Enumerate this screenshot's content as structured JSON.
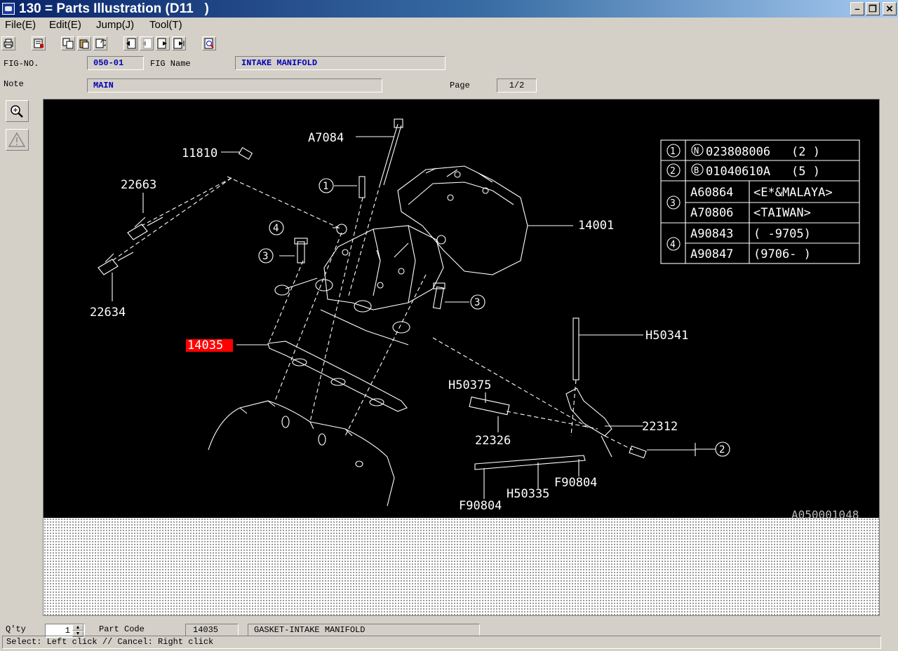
{
  "window": {
    "title": "130 = Parts Illustration (D11   )",
    "minimize_icon": "minimize-icon",
    "restore_icon": "restore-icon",
    "close_icon": "close-icon"
  },
  "menu": [
    "File(E)",
    "Edit(E)",
    "Jump(J)",
    "Tool(T)"
  ],
  "toolbar_icons": [
    "print-icon",
    "list-icon",
    "copy-icon",
    "paste-icon",
    "refresh-icon",
    "page-first-icon",
    "page-prev-icon",
    "page-next-icon",
    "page-last-icon",
    "detail-icon"
  ],
  "header": {
    "fig_no_label": "FIG-NO.",
    "fig_no_value": "050-01",
    "fig_name_label": "FIG Name",
    "fig_name_value": "INTAKE MANIFOLD",
    "note_label": "Note",
    "note_value": "MAIN",
    "page_label": "Page",
    "page_value": "1/2"
  },
  "side_tools": [
    "zoom-in-icon",
    "warning-icon"
  ],
  "illustration": {
    "image_code": "A050001048",
    "selected_part": "14035",
    "highlight_color": "#ff0000",
    "callouts": [
      "A7084",
      "11810",
      "22663",
      "22634",
      "14001",
      "H50341",
      "H50375",
      "22326",
      "22312",
      "F90804",
      "H50335",
      "F90804"
    ],
    "circle_refs": [
      "1",
      "2",
      "3",
      "3",
      "4",
      "2"
    ],
    "ref_table": [
      {
        "ref": "1",
        "badge": "N",
        "code": "023808006",
        "qty": "(2 )"
      },
      {
        "ref": "2",
        "badge": "B",
        "code": "01040610A",
        "qty": "(5 )"
      },
      {
        "ref": "3",
        "rows": [
          {
            "code": "A60864",
            "note": "<E*&MALAYA>"
          },
          {
            "code": "A70806",
            "note": "<TAIWAN>"
          }
        ]
      },
      {
        "ref": "4",
        "rows": [
          {
            "code": "A90843",
            "note": "(    -9705)"
          },
          {
            "code": "A90847",
            "note": "(9706-    )"
          }
        ]
      }
    ]
  },
  "footer": {
    "qty_label": "Q'ty",
    "qty_value": "1",
    "part_code_label": "Part Code",
    "part_code_value": "14035",
    "part_name_value": "GASKET-INTAKE MANIFOLD",
    "status_text": "Select: Left click // Cancel: Right click"
  }
}
